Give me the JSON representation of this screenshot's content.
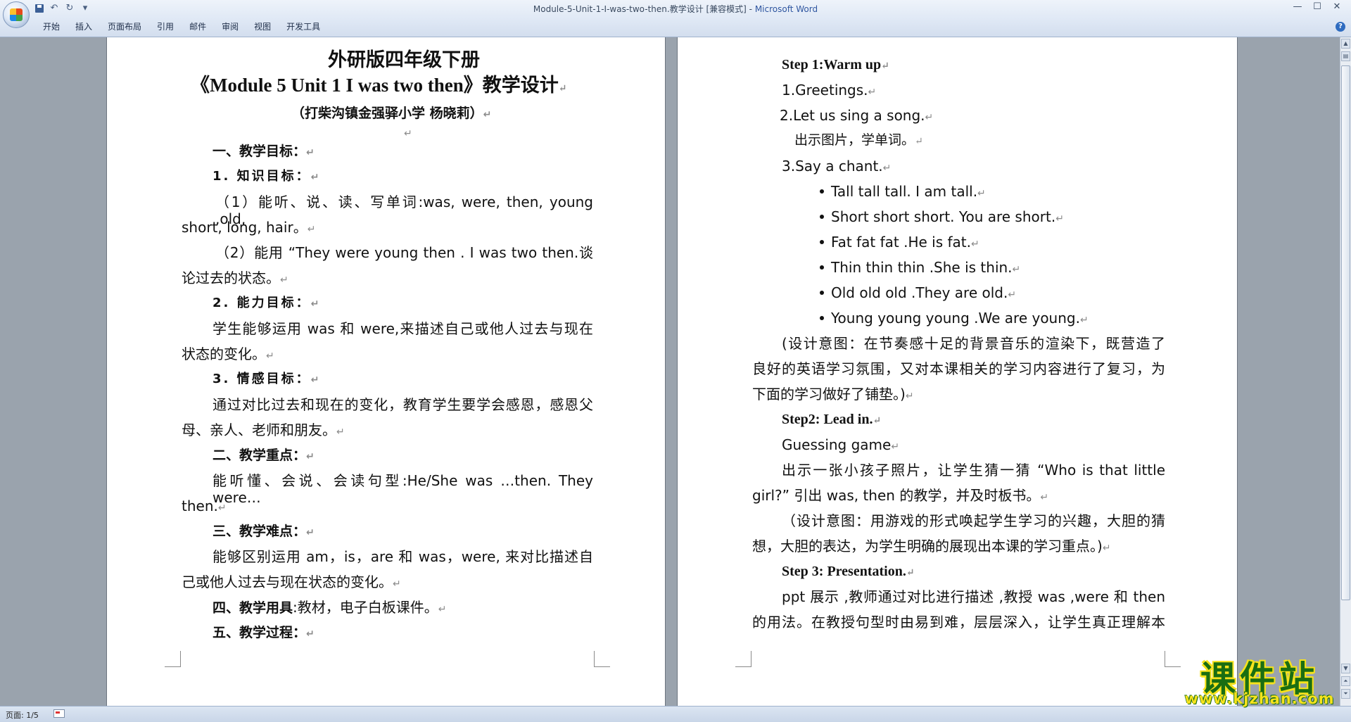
{
  "window": {
    "title_doc": "Module-5-Unit-1-I-was-two-then.教学设计 [兼容模式] - ",
    "title_app": "Microsoft Word"
  },
  "quick_access": {
    "save": "save-icon",
    "undo": "↶",
    "redo": "↻",
    "more": "▾"
  },
  "window_controls": {
    "minimize": "—",
    "maximize": "☐",
    "close": "✕"
  },
  "ribbon": {
    "tabs": [
      "开始",
      "插入",
      "页面布局",
      "引用",
      "邮件",
      "审阅",
      "视图",
      "开发工具"
    ],
    "help": "?"
  },
  "left_page": {
    "title1": "外研版四年级下册",
    "title2": "《Module 5 Unit 1 I was two then》教学设计",
    "subtitle": "（打柴沟镇金强驿小学     杨晓莉）",
    "sec1": "一、教学目标：",
    "sec1_1": "1. 知识目标：",
    "p1_l1": "（1）能听、说、读、写单词:was, were, then, young ,old,",
    "p1_l2": "short, long, hair。",
    "p2_l1": "（2）能用 “They were young then . I was two then.谈",
    "p2_l2": "论过去的状态。",
    "sec1_2": "2. 能力目标：",
    "p3_l1": "学生能够运用 was 和 were,来描述自己或他人过去与现在",
    "p3_l2": "状态的变化。",
    "sec1_3": "3. 情感目标：",
    "p4_l1": "通过对比过去和现在的变化，教育学生要学会感恩，感恩父",
    "p4_l2": "母、亲人、老师和朋友。",
    "sec2": "二、教学重点：",
    "p5_l1": "能听懂、会说、会读句型:He/She was  …then. They were…",
    "p5_l2": "then.",
    "sec3": "三、教学难点：",
    "p6_l1": "能够区别运用 am，is，are 和 was，were, 来对比描述自",
    "p6_l2": "己或他人过去与现在状态的变化。",
    "sec4_label": "四、教学用具",
    "sec4_text": ":教材，电子白板课件。",
    "sec5": "五、教学过程：",
    "mark": "↵"
  },
  "right_page": {
    "step1": "Step 1:Warm up",
    "r1": "1.Greetings.",
    "r2": "2.Let us sing a song.",
    "r3": "出示图片，学单词。",
    "r4": "3.Say a chant.",
    "bullets": [
      "Tall tall tall. I am tall.",
      "Short short short. You are short.",
      "Fat fat fat .He is fat.",
      "Thin thin thin .She is thin.",
      "Old old old .They are old.",
      "Young young young .We are young."
    ],
    "d1_l1": "(设计意图：在节奏感十足的背景音乐的渲染下，既营造了",
    "d1_l2": "良好的英语学习氛围，又对本课相关的学习内容进行了复习，为",
    "d1_l3": "下面的学习做好了铺垫。)",
    "step2": "Step2: Lead in.",
    "r5": "Guessing game",
    "r6_l1": "出示一张小孩子照片，让学生猜一猜 “Who  is  that  little",
    "r6_l2": "girl?” 引出 was, then 的教学，并及时板书。",
    "d2_l1": "（设计意图：用游戏的形式唤起学生学习的兴趣，大胆的猜",
    "d2_l2": "想，大胆的表达，为学生明确的展现出本课的学习重点。)",
    "step3": "Step 3: Presentation.",
    "r7_a": "ppt 展示 ,教师通过对比进行描述 ,教授 was ,were 和 then",
    "r7_l2": "的用法。在教授句型时由易到难，层层深入，让学生真正理解本",
    "mark": "↵"
  },
  "status": {
    "page": "页面: 1/5"
  },
  "watermark": {
    "title": "课件站",
    "url": "www.kjzhan.com"
  }
}
